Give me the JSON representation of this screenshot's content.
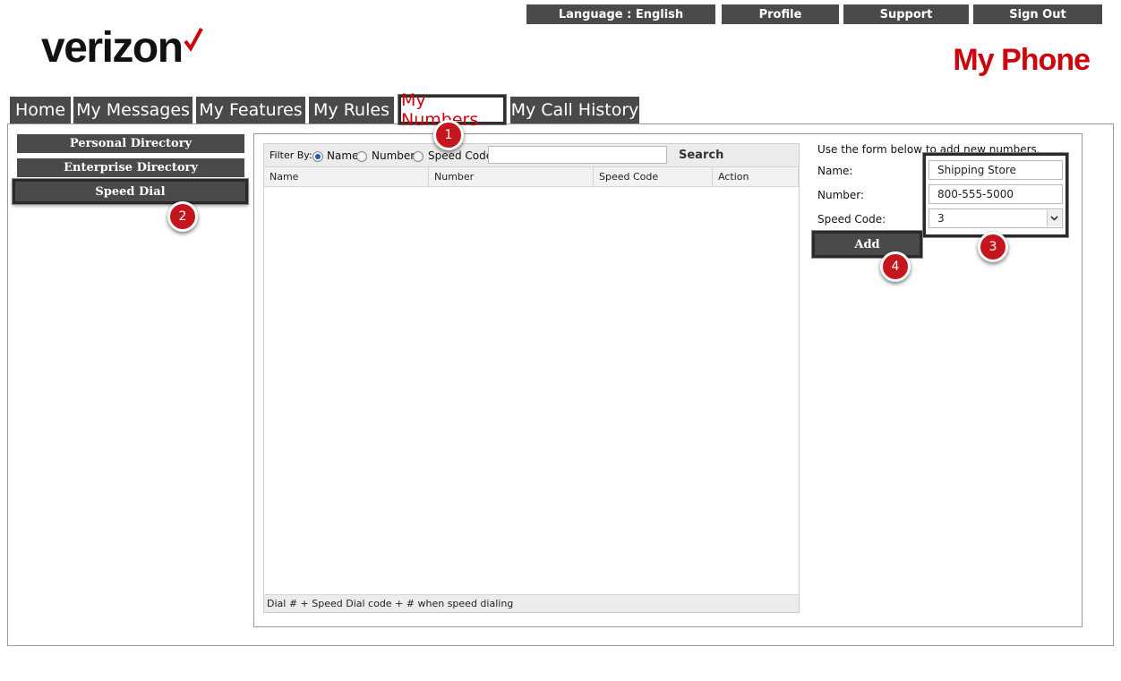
{
  "top_bar": {
    "language": "Language : English",
    "profile": "Profile",
    "support": "Support",
    "sign_out": "Sign Out"
  },
  "brand": {
    "logo_text": "verizon",
    "title": "My Phone",
    "accent_color": "#cd040b"
  },
  "nav": {
    "tabs": [
      {
        "label": "Home"
      },
      {
        "label": "My Messages"
      },
      {
        "label": "My Features"
      },
      {
        "label": "My Rules"
      },
      {
        "label": "My Numbers",
        "active": true
      },
      {
        "label": "My Call History"
      }
    ]
  },
  "sidebar": {
    "items": [
      {
        "label": "Personal Directory"
      },
      {
        "label": "Enterprise Directory"
      },
      {
        "label": "Speed Dial",
        "selected": true
      }
    ]
  },
  "grid": {
    "filter_label": "Filter By:",
    "filter_options": [
      "Name",
      "Number",
      "Speed Code"
    ],
    "filter_selected": "Name",
    "search_value": "",
    "search_button": "Search",
    "columns": [
      "Name",
      "Number",
      "Speed Code",
      "Action"
    ],
    "rows": [],
    "footer": "Dial # + Speed Dial code + # when speed dialing"
  },
  "form": {
    "instructions": "Use the form below to add new numbers.",
    "name_label": "Name:",
    "name_value": "Shipping Store",
    "number_label": "Number:",
    "number_value": "800-555-5000",
    "speed_code_label": "Speed Code:",
    "speed_code_value": "3",
    "add_button": "Add"
  },
  "markers": [
    "1",
    "2",
    "3",
    "4"
  ]
}
